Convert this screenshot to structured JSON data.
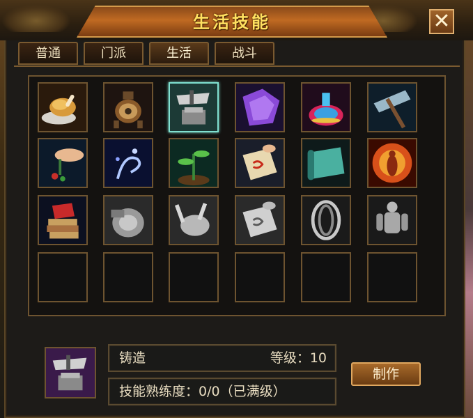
{
  "window": {
    "title": "生活技能",
    "close_label": "✕"
  },
  "tabs": [
    {
      "label": "普通",
      "active": false
    },
    {
      "label": "门派",
      "active": false
    },
    {
      "label": "生活",
      "active": true
    },
    {
      "label": "战斗",
      "active": false
    }
  ],
  "skills": [
    {
      "icon": "roast-chicken-icon",
      "learned": true
    },
    {
      "icon": "cauldron-icon",
      "learned": true
    },
    {
      "icon": "anvil-icon",
      "learned": true,
      "selected": true
    },
    {
      "icon": "robe-icon",
      "learned": true
    },
    {
      "icon": "potion-icon",
      "learned": true
    },
    {
      "icon": "pickaxe-icon",
      "learned": true
    },
    {
      "icon": "herb-picking-icon",
      "learned": true
    },
    {
      "icon": "spirit-icon",
      "learned": true
    },
    {
      "icon": "sprout-icon",
      "learned": true
    },
    {
      "icon": "talisman-icon",
      "learned": true
    },
    {
      "icon": "scroll-icon",
      "learned": true
    },
    {
      "icon": "flame-body-icon",
      "learned": true
    },
    {
      "icon": "books-icon",
      "learned": true
    },
    {
      "icon": "millstone-icon",
      "learned": false
    },
    {
      "icon": "chicken-icon",
      "learned": false
    },
    {
      "icon": "talisman-gray-icon",
      "learned": false
    },
    {
      "icon": "whirlwind-icon",
      "learned": false
    },
    {
      "icon": "muscle-body-icon",
      "learned": false
    },
    {
      "icon": "empty-slot",
      "learned": false
    },
    {
      "icon": "empty-slot",
      "learned": false
    },
    {
      "icon": "empty-slot",
      "learned": false
    },
    {
      "icon": "empty-slot",
      "learned": false
    },
    {
      "icon": "empty-slot",
      "learned": false
    },
    {
      "icon": "empty-slot",
      "learned": false
    }
  ],
  "detail": {
    "icon": "anvil-icon",
    "skill_name": "铸造",
    "level_text": "等级：10",
    "proficiency_text": "技能熟练度：0/0（已满级）",
    "make_button": "制作"
  }
}
